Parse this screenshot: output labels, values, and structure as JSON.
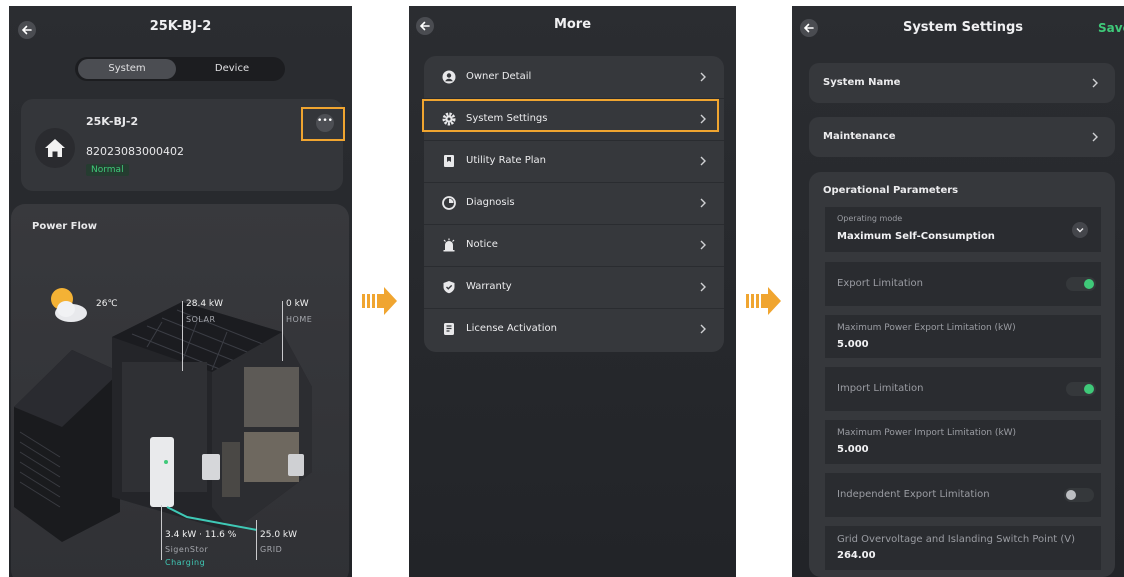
{
  "screen1": {
    "title": "25K-BJ-2",
    "tabs": [
      {
        "label": "System"
      },
      {
        "label": "Device"
      }
    ],
    "system_card": {
      "name": "25K-BJ-2",
      "serial": "82023083000402",
      "status": "Normal"
    },
    "more_label": "•••",
    "power_flow": {
      "title": "Power Flow",
      "weather_temp": "26℃",
      "solar": {
        "value": "28.4 kW",
        "label": "SOLAR"
      },
      "home": {
        "value": "0 kW",
        "label": "HOME"
      },
      "battery": {
        "value": "3.4 kW · 11.6 %",
        "label": "SigenStor",
        "state": "Charging"
      },
      "grid": {
        "value": "25.0 kW",
        "label": "GRID"
      }
    }
  },
  "screen2": {
    "title": "More",
    "items": [
      {
        "label": "Owner Detail",
        "icon": "user-icon"
      },
      {
        "label": "System Settings",
        "icon": "gear-icon"
      },
      {
        "label": "Utility Rate Plan",
        "icon": "bookmark-icon"
      },
      {
        "label": "Diagnosis",
        "icon": "diagnosis-icon"
      },
      {
        "label": "Notice",
        "icon": "notice-icon"
      },
      {
        "label": "Warranty",
        "icon": "shield-icon"
      },
      {
        "label": "License Activation",
        "icon": "license-icon"
      }
    ]
  },
  "screen3": {
    "title": "System Settings",
    "save_label": "Save",
    "system_name_label": "System Name",
    "maintenance_label": "Maintenance",
    "params_title": "Operational Parameters",
    "operating_mode": {
      "label": "Operating mode",
      "value": "Maximum Self-Consumption"
    },
    "export_limitation": {
      "label": "Export Limitation",
      "enabled": true
    },
    "max_export": {
      "label": "Maximum Power Export Limitation (kW)",
      "value": "5.000"
    },
    "import_limitation": {
      "label": "Import Limitation",
      "enabled": true
    },
    "max_import": {
      "label": "Maximum Power Import Limitation (kW)",
      "value": "5.000"
    },
    "independent_export": {
      "label": "Independent Export Limitation",
      "enabled": false
    },
    "grid_overvoltage": {
      "label": "Grid Overvoltage and Islanding Switch Point (V)",
      "value": "264.00"
    }
  },
  "colors": {
    "accent_green": "#3fc979",
    "highlight_orange": "#f0a530",
    "background": "#2b2d31"
  }
}
